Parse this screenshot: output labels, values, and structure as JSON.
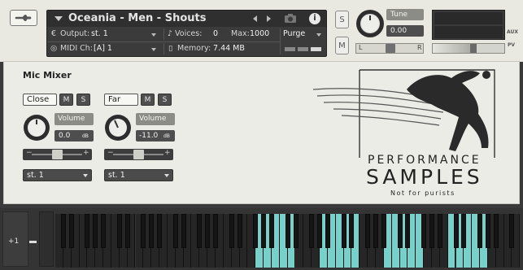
{
  "header": {
    "instrument_title": "Oceania - Men - Shouts",
    "output_label": "Output:",
    "output_value": "st. 1",
    "voices_label": "Voices:",
    "voices_value": "0",
    "max_label": "Max:",
    "max_value": "1000",
    "purge_label": "Purge",
    "midi_label": "MIDI Ch:",
    "midi_value": "[A]  1",
    "memory_label": "Memory:",
    "memory_value": "7.44 MB",
    "s_label": "S",
    "m_label": "M",
    "tune_label": "Tune",
    "tune_value": "0.00",
    "pan_left": "L",
    "pan_right": "R",
    "aux_label": "AUX",
    "pv_label": "PV",
    "info_label": "i"
  },
  "mic_mixer": {
    "title": "Mic Mixer",
    "channels": [
      {
        "name": "Close",
        "m": "M",
        "s": "S",
        "knob_label": "Volume",
        "volume": "0.0",
        "unit": "dB",
        "output": "st. 1"
      },
      {
        "name": "Far",
        "m": "M",
        "s": "S",
        "knob_label": "Volume",
        "volume": "-11.0",
        "unit": "dB",
        "output": "st. 1"
      }
    ]
  },
  "logo": {
    "line1": "PERFORMANCE",
    "line2": "SAMPLES",
    "tagline": "Not for purists"
  },
  "keyboard": {
    "octave_label": "+1",
    "key_color": "#77d0c9"
  },
  "colors": {
    "panel": "#ecece6",
    "header_dark": "#3b3b3b",
    "accent_key": "#77d0c9"
  }
}
